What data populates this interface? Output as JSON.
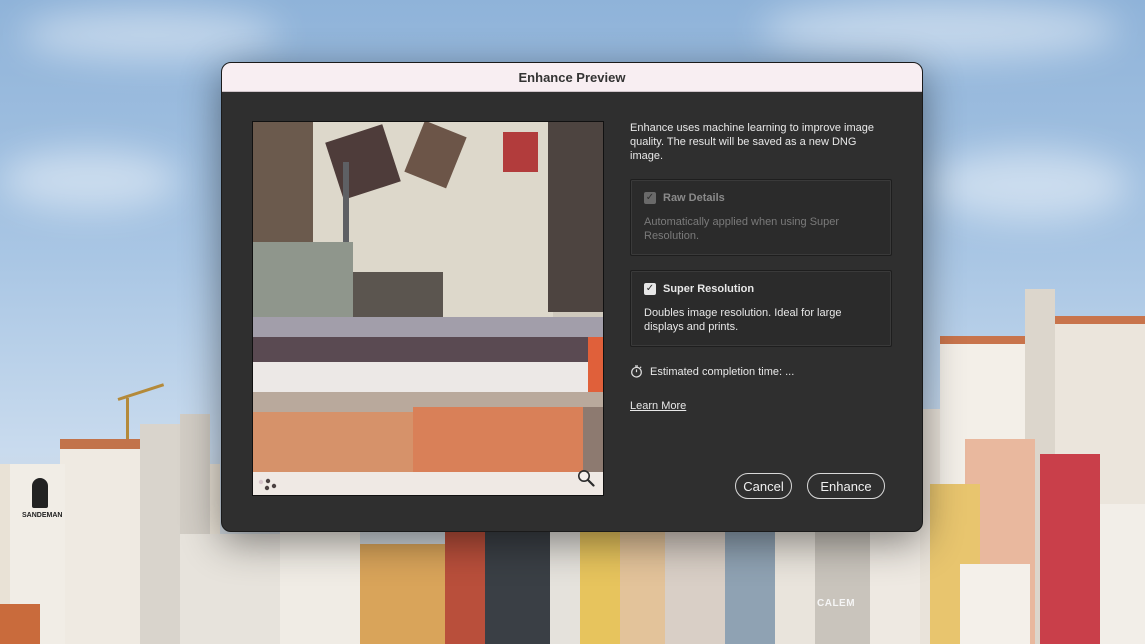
{
  "dialog": {
    "title": "Enhance Preview",
    "description": "Enhance uses machine learning to improve image quality. The result will be saved as a new DNG image.",
    "options": [
      {
        "label": "Raw Details",
        "description": "Automatically applied when using Super Resolution.",
        "checked": true,
        "enabled": false
      },
      {
        "label": "Super Resolution",
        "description": "Doubles image resolution. Ideal for large displays and prints.",
        "checked": true,
        "enabled": true
      }
    ],
    "estimate_label": "Estimated completion time: ...",
    "learn_more": "Learn More",
    "cancel_label": "Cancel",
    "enhance_label": "Enhance",
    "checkmark": "✓"
  },
  "background": {
    "signs": [
      "SANDEMAN",
      "CALEM"
    ]
  },
  "icons": {
    "zoom": "magnifier-icon",
    "timer": "stopwatch-icon",
    "loader": "loading-dots-icon"
  },
  "colors": {
    "dialog_bg": "#2f2f2f",
    "titlebar_bg": "#f8eef2",
    "text": "#e8e8e8"
  }
}
